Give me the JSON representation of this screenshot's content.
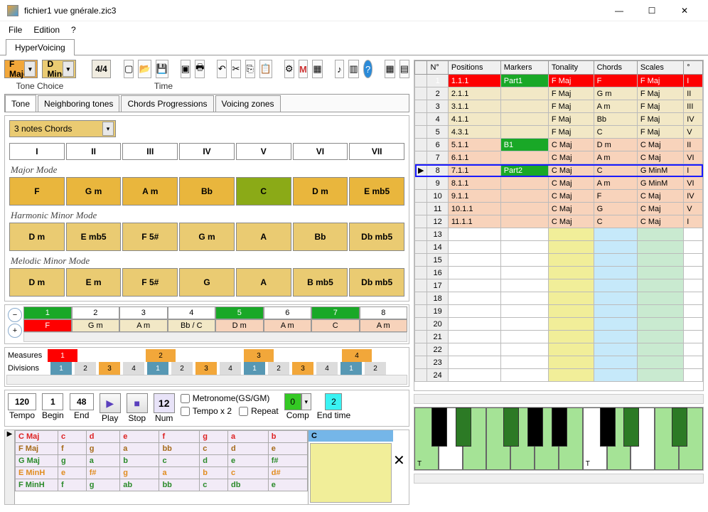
{
  "window": {
    "title": "fichier1 vue gnérale.zic3"
  },
  "menu": {
    "file": "File",
    "edition": "Edition",
    "help": "?"
  },
  "doctab": "HyperVoicing",
  "tone": {
    "key1": "F Major",
    "key2": "D Minor",
    "timesig": "4/4",
    "label_tone": "Tone Choice",
    "label_time": "Time"
  },
  "tabs": {
    "t1": "Tone",
    "t2": "Neighboring tones",
    "t3": "Chords Progressions",
    "t4": "Voicing zones"
  },
  "chordsel": "3 notes Chords",
  "degrees": [
    "I",
    "II",
    "III",
    "IV",
    "V",
    "VI",
    "VII"
  ],
  "modes": {
    "major": {
      "label": "Major Mode",
      "cells": [
        "F",
        "G m",
        "A m",
        "Bb",
        "C",
        "D m",
        "E mb5"
      ]
    },
    "harm": {
      "label": "Harmonic Minor Mode",
      "cells": [
        "D m",
        "E mb5",
        "F 5#",
        "G m",
        "A",
        "Bb",
        "Db mb5"
      ]
    },
    "mel": {
      "label": "Melodic Minor Mode",
      "cells": [
        "D m",
        "E m",
        "F 5#",
        "G",
        "A",
        "B mb5",
        "Db mb5"
      ]
    }
  },
  "seq": {
    "head": [
      "1",
      "2",
      "3",
      "4",
      "5",
      "6",
      "7",
      "8"
    ],
    "body": [
      "F",
      "G m",
      "A m",
      "Bb / C",
      "D m",
      "A m",
      "C",
      "A m"
    ]
  },
  "meas": {
    "lbl1": "Measures",
    "lbl2": "Divisions",
    "measures": [
      "1",
      "",
      "",
      "2",
      "",
      "",
      "3",
      "",
      "",
      "4",
      ""
    ],
    "divisions": [
      "1",
      "2",
      "3",
      "4",
      "1",
      "2",
      "3",
      "4",
      "1",
      "2",
      "3",
      "4",
      "1",
      "2"
    ]
  },
  "play": {
    "tempo": "120",
    "begin": "1",
    "end": "48",
    "lbl_tempo": "Tempo",
    "lbl_begin": "Begin",
    "lbl_end": "End",
    "lbl_play": "Play",
    "lbl_stop": "Stop",
    "lbl_num": "Num",
    "num": "12",
    "ck_metro": "Metronome(GS/GM)",
    "ck_tx2": "Tempo x 2",
    "ck_rep": "Repeat",
    "comp": "0",
    "lbl_comp": "Comp",
    "endtime": "2",
    "lbl_endtime": "End time"
  },
  "scales": {
    "cols": [
      "",
      "c",
      "d",
      "e",
      "f",
      "g",
      "a",
      "b"
    ],
    "rows": [
      {
        "n": "C Maj",
        "cls": "sc-red",
        "c": [
          "c",
          "d",
          "e",
          "f",
          "g",
          "a",
          "b"
        ]
      },
      {
        "n": "F Maj",
        "cls": "sc-brn",
        "c": [
          "f",
          "g",
          "a",
          "bb",
          "c",
          "d",
          "e"
        ]
      },
      {
        "n": "G Maj",
        "cls": "sc-grn",
        "c": [
          "g",
          "a",
          "b",
          "c",
          "d",
          "e",
          "f#"
        ]
      },
      {
        "n": "E MinH",
        "cls": "sc-org",
        "c": [
          "e",
          "f#",
          "g",
          "a",
          "b",
          "c",
          "d#"
        ]
      },
      {
        "n": "F MinH",
        "cls": "sc-grn",
        "c": [
          "f",
          "g",
          "ab",
          "bb",
          "c",
          "db",
          "e"
        ]
      }
    ],
    "notehdr": "C"
  },
  "grid": {
    "cols": [
      "N°",
      "Positions",
      "Markers",
      "Tonality",
      "Chords",
      "Scales",
      "°"
    ],
    "rows": [
      {
        "n": 1,
        "pos": "1.1.1",
        "mk": "Part1",
        "ton": "F Maj",
        "ch": "F",
        "sc": "F Maj",
        "dg": "I",
        "style": "red",
        "mkstyle": "grn"
      },
      {
        "n": 2,
        "pos": "2.1.1",
        "mk": "",
        "ton": "F Maj",
        "ch": "G m",
        "sc": "F Maj",
        "dg": "II",
        "style": "tan"
      },
      {
        "n": 3,
        "pos": "3.1.1",
        "mk": "",
        "ton": "F Maj",
        "ch": "A m",
        "sc": "F Maj",
        "dg": "III",
        "style": "tan"
      },
      {
        "n": 4,
        "pos": "4.1.1",
        "mk": "",
        "ton": "F Maj",
        "ch": "Bb",
        "sc": "F Maj",
        "dg": "IV",
        "style": "tan"
      },
      {
        "n": 5,
        "pos": "4.3.1",
        "mk": "",
        "ton": "F Maj",
        "ch": "C",
        "sc": "F Maj",
        "dg": "V",
        "style": "tan"
      },
      {
        "n": 6,
        "pos": "5.1.1",
        "mk": "B1",
        "ton": "C Maj",
        "ch": "D m",
        "sc": "C Maj",
        "dg": "II",
        "style": "pk",
        "mkstyle": "grn"
      },
      {
        "n": 7,
        "pos": "6.1.1",
        "mk": "",
        "ton": "C Maj",
        "ch": "A m",
        "sc": "C Maj",
        "dg": "VI",
        "style": "pk"
      },
      {
        "n": 8,
        "pos": "7.1.1",
        "mk": "Part2",
        "ton": "C Maj",
        "ch": "C",
        "sc": "G MinM",
        "dg": "I",
        "style": "pk",
        "mkstyle": "grn",
        "sel": true
      },
      {
        "n": 9,
        "pos": "8.1.1",
        "mk": "",
        "ton": "C Maj",
        "ch": "A m",
        "sc": "G MinM",
        "dg": "VI",
        "style": "pk"
      },
      {
        "n": 10,
        "pos": "9.1.1",
        "mk": "",
        "ton": "C Maj",
        "ch": "F",
        "sc": "C Maj",
        "dg": "IV",
        "style": "pk"
      },
      {
        "n": 11,
        "pos": "10.1.1",
        "mk": "",
        "ton": "C Maj",
        "ch": "G",
        "sc": "C Maj",
        "dg": "V",
        "style": "pk"
      },
      {
        "n": 12,
        "pos": "11.1.1",
        "mk": "",
        "ton": "C Maj",
        "ch": "C",
        "sc": "C Maj",
        "dg": "I",
        "style": "pk"
      }
    ],
    "blank": [
      13,
      14,
      15,
      16,
      17,
      18,
      19,
      20,
      21,
      22,
      23,
      24
    ]
  }
}
